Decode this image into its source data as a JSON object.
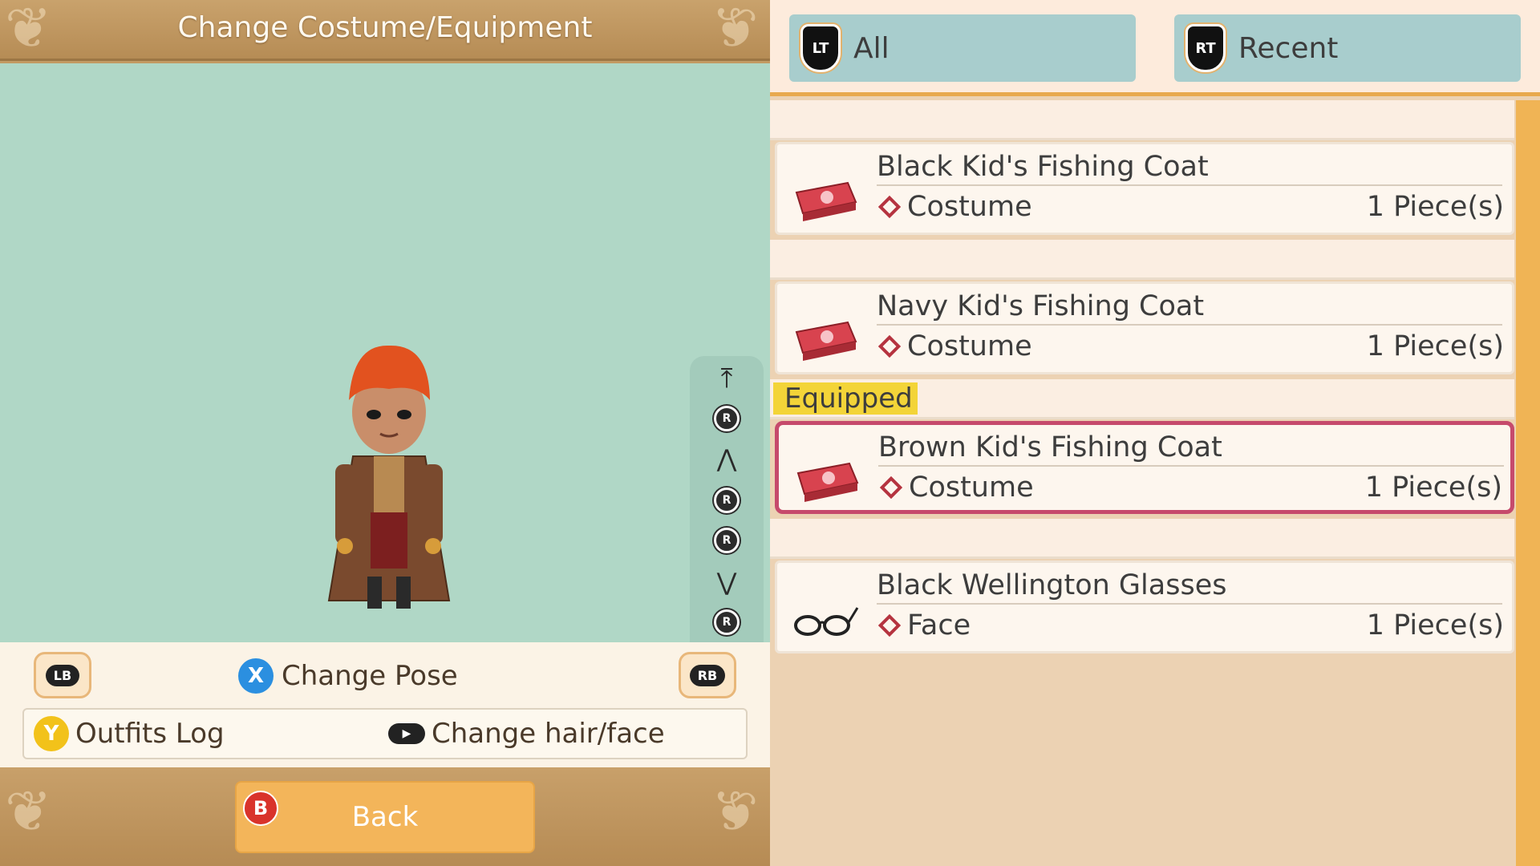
{
  "header": {
    "title": "Change Costume/Equipment"
  },
  "camera_controls": {
    "items": [
      {
        "icon": "scroll-top-icon",
        "glyph": "⤒"
      },
      {
        "icon": "r-stick-up-icon",
        "label": "R"
      },
      {
        "icon": "zoom-in-icon",
        "glyph": "⋀"
      },
      {
        "icon": "r-stick-left-icon",
        "label": "R"
      },
      {
        "icon": "r-stick-right-icon",
        "label": "R"
      },
      {
        "icon": "zoom-out-icon",
        "glyph": "⋁"
      },
      {
        "icon": "r-stick-down-icon",
        "label": "R"
      },
      {
        "icon": "scroll-bottom-icon",
        "glyph": "⤓"
      }
    ]
  },
  "controls": {
    "lb_label": "LB",
    "rb_label": "RB",
    "x_label": "X",
    "change_pose": "Change Pose",
    "y_label": "Y",
    "outfits_log": "Outfits Log",
    "change_hair_face": "Change hair/face"
  },
  "back_button": {
    "b_label": "B",
    "label": "Back"
  },
  "tabs": [
    {
      "button": "LT",
      "label": "All"
    },
    {
      "button": "RT",
      "label": "Recent"
    }
  ],
  "items": [
    {
      "name": "Black Kid's Fishing Coat",
      "type": "Costume",
      "qty": "1 Piece(s)",
      "icon": "costume-case-icon"
    },
    {
      "name": "Navy Kid's Fishing Coat",
      "type": "Costume",
      "qty": "1 Piece(s)",
      "icon": "costume-case-icon"
    },
    {
      "name": "Brown Kid's Fishing Coat",
      "type": "Costume",
      "qty": "1 Piece(s)",
      "icon": "costume-case-icon",
      "equipped": true,
      "selected": true
    },
    {
      "name": "Black Wellington Glasses",
      "type": "Face",
      "qty": "1 Piece(s)",
      "icon": "glasses-icon"
    }
  ],
  "equipped_label": "Equipped",
  "colors": {
    "accent_orange": "#f0b455",
    "selected_border": "#c64a6c",
    "viewport_bg": "#b0d7c6",
    "tab_bg": "#a8cdcd",
    "equipped_tag": "#f3d438"
  }
}
